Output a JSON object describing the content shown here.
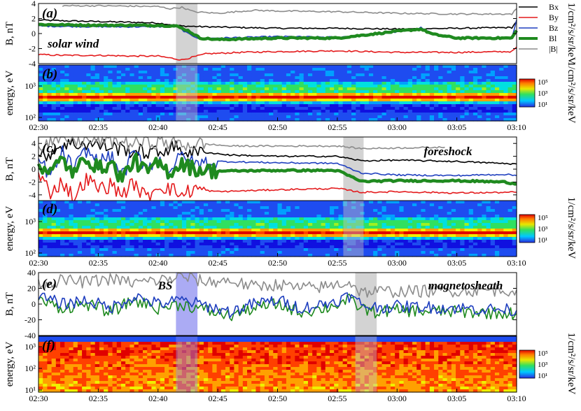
{
  "chart_data": [
    {
      "type": "line",
      "panel_label": "(a)",
      "annotation": "solar wind",
      "ylabel": "B, nT",
      "ylim": [
        -4,
        4
      ],
      "yticks": [
        "4",
        "2",
        "0",
        "-2",
        "-4"
      ],
      "xlim": [
        "02:30",
        "03:10"
      ],
      "highlight": [
        {
          "start": "02:41.5",
          "end": "02:43.3",
          "color": "#c4c4c4"
        }
      ],
      "series": [
        {
          "name": "Bx",
          "color": "#000000",
          "x": [
            "02:30",
            "02:32",
            "02:35",
            "02:38",
            "02:40",
            "02:42",
            "02:44",
            "02:47",
            "02:50",
            "02:55",
            "03:00",
            "03:05",
            "03:09.6",
            "03:10"
          ],
          "values": [
            1.8,
            1.7,
            1.6,
            1.5,
            1.4,
            1.0,
            0.9,
            0.8,
            0.7,
            0.7,
            0.6,
            0.7,
            0.8,
            1.6
          ]
        },
        {
          "name": "By",
          "color": "#e41a1c",
          "x": [
            "02:30",
            "02:32",
            "02:35",
            "02:38",
            "02:40",
            "02:42",
            "02:44",
            "02:47",
            "02:50",
            "02:55",
            "03:00",
            "03:05",
            "03:09.6",
            "03:10"
          ],
          "values": [
            -2.8,
            -2.9,
            -2.9,
            -3.0,
            -3.0,
            -3.5,
            -2.7,
            -2.5,
            -2.4,
            -2.3,
            -2.5,
            -2.5,
            -2.4,
            -1.8
          ]
        },
        {
          "name": "Bz",
          "color": "#1f3fbf",
          "x": [
            "02:30",
            "02:35",
            "02:40",
            "02:41.5",
            "02:42.5",
            "02:43.5",
            "02:45",
            "02:50",
            "02:55",
            "03:00",
            "03:02",
            "03:03",
            "03:05",
            "03:09.6",
            "03:10"
          ],
          "values": [
            1.0,
            0.9,
            0.9,
            1.0,
            0.0,
            -0.7,
            -0.6,
            -0.4,
            -0.5,
            0.2,
            0.8,
            0.0,
            -0.6,
            -0.6,
            1.8
          ]
        },
        {
          "name": "Bl",
          "color": "#1f8a1f",
          "width": 4.5,
          "x": [
            "02:30",
            "02:35",
            "02:40",
            "02:41.5",
            "02:42.5",
            "02:43.5",
            "02:45",
            "02:50",
            "02:55",
            "03:00",
            "03:02",
            "03:03",
            "03:05",
            "03:09.6",
            "03:10"
          ],
          "values": [
            1.2,
            1.1,
            1.1,
            1.0,
            0.4,
            -0.6,
            -0.8,
            -0.6,
            -0.6,
            0.3,
            0.6,
            -0.1,
            -0.6,
            -0.6,
            0.4
          ]
        },
        {
          "name": "|B|",
          "color": "#8c8c8c",
          "x": [
            "02:32",
            "02:35",
            "02:40",
            "02:41",
            "02:42",
            "02:43",
            "02:45",
            "02:48",
            "02:50",
            "02:55",
            "03:00",
            "03:05",
            "03:09.6",
            "03:10"
          ],
          "values": [
            3.7,
            3.7,
            3.6,
            3.3,
            3.5,
            2.9,
            2.7,
            3.1,
            3.0,
            2.9,
            2.7,
            2.6,
            2.6,
            3.3
          ]
        }
      ],
      "legend": [
        "Bx",
        "By",
        "Bz",
        "Bl",
        "|B|"
      ]
    },
    {
      "type": "heatmap",
      "panel_label": "(b)",
      "ylabel": "energy, eV",
      "yticks": [
        "10³",
        "10²"
      ],
      "xlim": [
        "02:30",
        "03:10"
      ],
      "xticks": [
        "02:30",
        "02:35",
        "02:40",
        "02:45",
        "02:50",
        "02:55",
        "03:00",
        "03:05",
        "03:10"
      ],
      "highlight": [
        {
          "start": "02:41.5",
          "end": "02:43.3",
          "color": "#c4c4c4"
        }
      ],
      "colorbar": {
        "label": "1/cm²/s/sr/keV",
        "ticks": [
          "10⁵",
          "10³",
          "10¹"
        ]
      }
    },
    {
      "type": "line",
      "panel_label": "(c)",
      "annotation": "foreshock",
      "ylabel": "B, nT",
      "ylim": [
        -5,
        5
      ],
      "yticks": [
        "4",
        "2",
        "0",
        "-2",
        "-4"
      ],
      "xlim": [
        "02:30",
        "03:10"
      ],
      "highlight": [
        {
          "start": "02:55.5",
          "end": "02:57.2",
          "color": "#c4c4c4"
        }
      ],
      "series": [
        {
          "name": "Bx",
          "color": "#000000",
          "x": [
            "02:30",
            "02:32",
            "02:34",
            "02:36",
            "02:38",
            "02:40",
            "02:41",
            "02:43",
            "02:44",
            "02:46",
            "02:50",
            "02:55",
            "02:57",
            "03:00",
            "03:05",
            "03:10"
          ],
          "values": [
            1.5,
            3.8,
            4.0,
            3.5,
            2.8,
            2.5,
            3.5,
            2.5,
            2.6,
            2.2,
            2.0,
            2.0,
            1.3,
            1.4,
            1.2,
            0.8
          ]
        },
        {
          "name": "By",
          "color": "#e41a1c",
          "x": [
            "02:30",
            "02:31",
            "02:32",
            "02:33",
            "02:34",
            "02:35",
            "02:36",
            "02:37",
            "02:38",
            "02:39",
            "02:40",
            "02:41",
            "02:42",
            "02:43",
            "02:44",
            "02:45",
            "02:50",
            "02:55",
            "02:57",
            "03:00",
            "03:05",
            "03:10"
          ],
          "values": [
            -1.0,
            -3.5,
            -2.0,
            -4.5,
            -1.5,
            -3.0,
            -2.5,
            -3.8,
            -2.2,
            -4.5,
            -2.5,
            -3.0,
            -4.0,
            -3.0,
            -3.3,
            -3.5,
            -3.2,
            -3.0,
            -3.6,
            -3.5,
            -3.7,
            -3.6
          ]
        },
        {
          "name": "Bz",
          "color": "#1f3fbf",
          "x": [
            "02:30",
            "02:31",
            "02:32",
            "02:33",
            "02:34",
            "02:35",
            "02:36",
            "02:37",
            "02:38",
            "02:39",
            "02:40",
            "02:41",
            "02:42",
            "02:43",
            "02:45",
            "02:50",
            "02:55",
            "02:57",
            "03:00",
            "03:05",
            "03:09",
            "03:10"
          ],
          "values": [
            1.5,
            -1.0,
            2.5,
            0.0,
            3.0,
            1.0,
            2.0,
            -1.0,
            2.5,
            0.5,
            1.5,
            0.0,
            2.0,
            0.8,
            1.2,
            1.0,
            0.9,
            -0.6,
            -0.9,
            -1.0,
            -0.8,
            -1.0
          ]
        },
        {
          "name": "Bl",
          "color": "#1f8a1f",
          "width": 4.5,
          "x": [
            "02:30",
            "02:31",
            "02:32",
            "02:33",
            "02:34",
            "02:35",
            "02:36",
            "02:37",
            "02:38",
            "02:39",
            "02:40",
            "02:41",
            "02:42",
            "02:43",
            "02:45",
            "02:50",
            "02:55",
            "02:57",
            "03:00",
            "03:05",
            "03:09",
            "03:10"
          ],
          "values": [
            1.0,
            -0.5,
            1.5,
            -0.8,
            2.0,
            0.0,
            1.0,
            -1.5,
            1.5,
            -0.5,
            0.8,
            -0.5,
            1.0,
            0.0,
            -0.3,
            -0.2,
            -0.2,
            -1.9,
            -1.8,
            -1.8,
            -2.0,
            -2.3
          ]
        },
        {
          "name": "|B|",
          "color": "#8c8c8c",
          "x": [
            "02:30",
            "02:32",
            "02:34",
            "02:36",
            "02:38",
            "02:40",
            "02:42",
            "02:44",
            "02:46",
            "02:50",
            "02:55",
            "02:57",
            "03:00",
            "03:04"
          ],
          "values": [
            3.8,
            4.6,
            4.4,
            4.5,
            4.0,
            4.3,
            3.8,
            3.9,
            3.6,
            3.6,
            3.6,
            3.2,
            3.3,
            3.4
          ]
        }
      ]
    },
    {
      "type": "heatmap",
      "panel_label": "(d)",
      "ylabel": "energy, eV",
      "yticks": [
        "10³",
        "10²"
      ],
      "xlim": [
        "02:30",
        "03:10"
      ],
      "xticks": [
        "02:30",
        "02:35",
        "02:40",
        "02:45",
        "02:50",
        "02:55",
        "03:00",
        "03:05",
        "03:10"
      ],
      "highlight": [
        {
          "start": "02:55.5",
          "end": "02:57.2",
          "color": "#c4c4c4"
        }
      ],
      "colorbar": {
        "label": "1/cm²/s/sr/keV",
        "ticks": [
          "10⁵",
          "10³",
          "10¹"
        ]
      }
    },
    {
      "type": "line",
      "panel_label": "(e)",
      "annotation": "magnetosheath",
      "annotation2": "BS",
      "ylabel": "B, nT",
      "ylim": [
        -40,
        40
      ],
      "yticks": [
        "40",
        "20",
        "0",
        "-20",
        "-40"
      ],
      "xlim": [
        "02:30",
        "03:10"
      ],
      "highlight": [
        {
          "start": "02:41.5",
          "end": "02:43.3",
          "color": "#8f8ff0"
        },
        {
          "start": "02:56.5",
          "end": "02:58.3",
          "color": "#c4c4c4"
        }
      ],
      "series": [
        {
          "name": "Bl",
          "color": "#1f8a1f",
          "x": [
            "02:30",
            "02:32",
            "02:34",
            "02:36",
            "02:38",
            "02:40",
            "02:42",
            "02:44",
            "02:46",
            "02:48",
            "02:50",
            "02:52",
            "02:54",
            "02:56",
            "02:57",
            "02:58",
            "03:00",
            "03:05",
            "03:10"
          ],
          "values": [
            5,
            -5,
            0,
            -10,
            5,
            -5,
            0,
            -8,
            -15,
            -5,
            0,
            -10,
            -5,
            5,
            -5,
            -10,
            -8,
            -10,
            -12
          ]
        },
        {
          "name": "Bz",
          "color": "#1f3fbf",
          "x": [
            "02:30",
            "02:32",
            "02:34",
            "02:36",
            "02:38",
            "02:40",
            "02:42",
            "02:44",
            "02:46",
            "02:48",
            "02:50",
            "02:52",
            "02:54",
            "02:56",
            "02:57",
            "02:58",
            "03:00",
            "03:05",
            "03:10"
          ],
          "values": [
            10,
            0,
            5,
            -5,
            10,
            0,
            5,
            -2,
            -10,
            0,
            5,
            -5,
            0,
            10,
            0,
            -4,
            -3,
            -5,
            -8
          ]
        },
        {
          "name": "|B|",
          "color": "#8c8c8c",
          "x": [
            "02:30",
            "02:32",
            "02:34",
            "02:36",
            "02:38",
            "02:40",
            "02:42",
            "02:44",
            "02:46",
            "02:48",
            "02:50",
            "02:52",
            "02:54",
            "02:56",
            "02:57",
            "02:58",
            "03:00",
            "03:05",
            "03:10"
          ],
          "values": [
            25,
            30,
            28,
            32,
            27,
            30,
            35,
            28,
            30,
            22,
            25,
            20,
            22,
            28,
            15,
            16,
            16,
            17,
            18
          ]
        }
      ]
    },
    {
      "type": "heatmap",
      "panel_label": "(f)",
      "ylabel": "energy, eV",
      "yticks": [
        "10³",
        "10²",
        "10¹"
      ],
      "xlim": [
        "02:30",
        "03:10"
      ],
      "xticks": [
        "02:30",
        "02:35",
        "02:40",
        "02:45",
        "02:50",
        "02:55",
        "03:00",
        "03:05",
        "03:10"
      ],
      "highlight": [
        {
          "start": "02:41.5",
          "end": "02:43.3",
          "color": "#8f8ff0"
        },
        {
          "start": "02:56.5",
          "end": "02:58.3",
          "color": "#c4c4c4"
        }
      ],
      "colorbar": {
        "label": "1/cm²/s/sr/keV",
        "ticks": [
          "10⁵",
          "10³",
          "10¹"
        ]
      }
    }
  ]
}
